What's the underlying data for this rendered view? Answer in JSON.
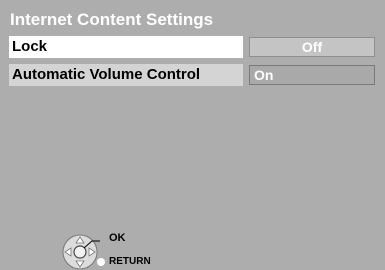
{
  "screen": {
    "title": "Internet Content Settings"
  },
  "settings": [
    {
      "label": "Lock",
      "value": "Off"
    },
    {
      "label": "Automatic Volume Control",
      "value": "On"
    }
  ],
  "hints": {
    "ok": "OK",
    "return": "RETURN"
  },
  "colors": {
    "background": "#adadad",
    "selected_row": "#ffffff",
    "unselected_row": "#d4d4d4",
    "text_light": "#ffffff"
  },
  "icons": {
    "navigation": "dpad-ok-icon",
    "return": "return-dot-icon"
  }
}
